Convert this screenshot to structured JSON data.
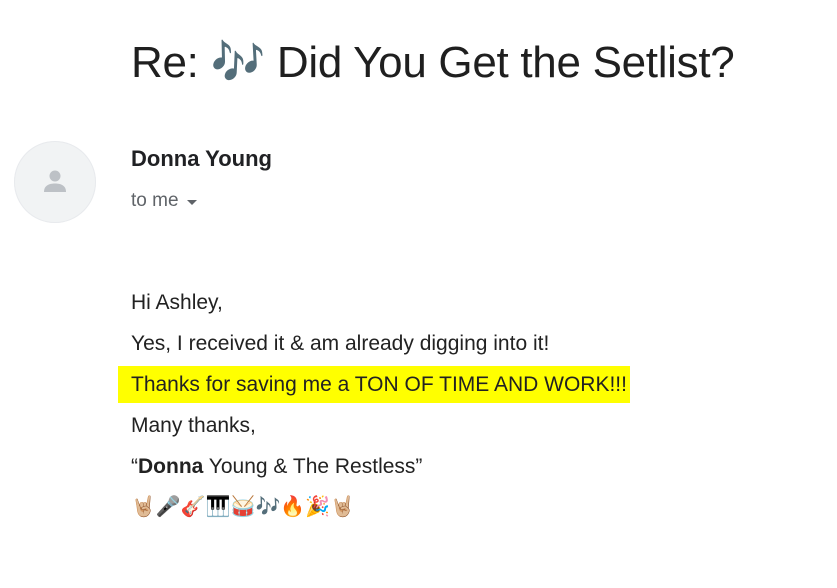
{
  "email": {
    "subject": "Re: 🎶 Did You Get the Setlist?",
    "sender": {
      "name": "Donna Young",
      "avatar_icon": "person-icon"
    },
    "recipients_label": "to me",
    "body": {
      "greeting": "Hi Ashley,",
      "line1": "Yes, I received it & am already digging into it!",
      "highlighted_line": "Thanks for saving me a TON OF TIME AND WORK!!!",
      "closing": "Many thanks,",
      "signature": {
        "open_quote": "“",
        "bold_name": "Donna",
        "rest": " Young & The Restless”"
      },
      "emoji_line": "🤘🏼🎤🎸🎹🥁🎶🔥🎉🤘🏼"
    },
    "colors": {
      "highlight": "#ffff00",
      "avatar_bg": "#f1f3f4",
      "muted_text": "#5f6368"
    }
  }
}
